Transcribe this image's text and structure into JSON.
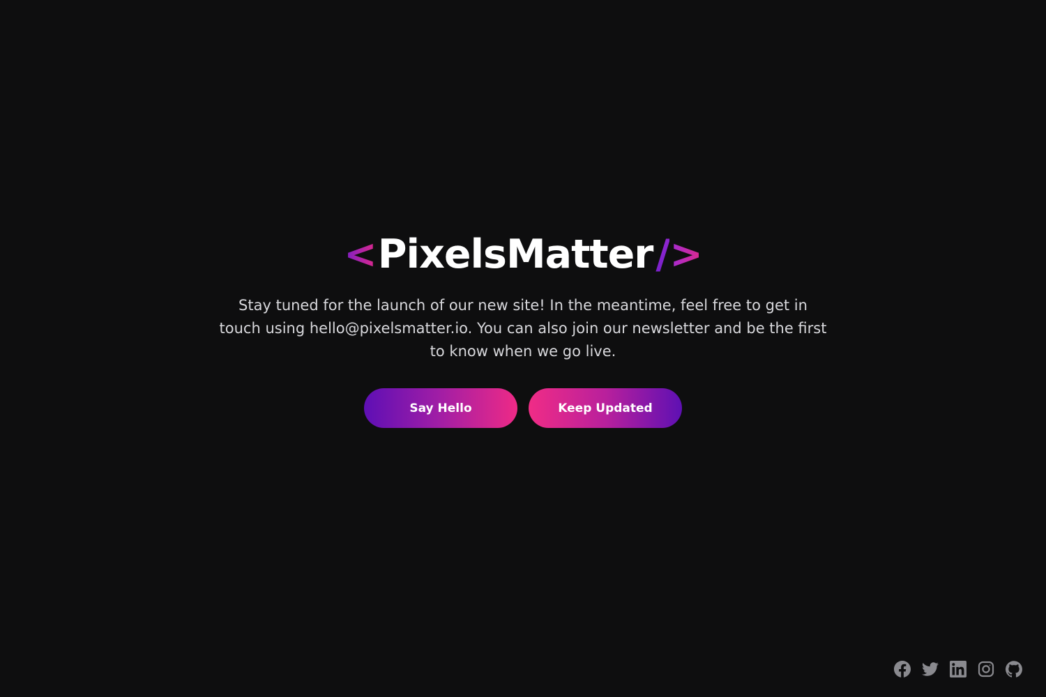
{
  "logo": {
    "open": "<",
    "name": "PixelsMatter",
    "slash": "/",
    "close": ">"
  },
  "tagline": "Stay tuned for the launch of our new site! In the meantime, feel free to get in touch using hello@pixelsmatter.io. You can also join our newsletter and be the first to know when we go live.",
  "buttons": {
    "say_hello": "Say Hello",
    "keep_updated": "Keep Updated"
  },
  "social": [
    "facebook-icon",
    "twitter-icon",
    "linkedin-icon",
    "instagram-icon",
    "github-icon"
  ],
  "colors": {
    "background": "#0e0e0f",
    "accent_purple": "#5e0fb5",
    "accent_pink": "#ee2a86",
    "text": "#d8d8dc",
    "icon": "#8a8a8f"
  }
}
